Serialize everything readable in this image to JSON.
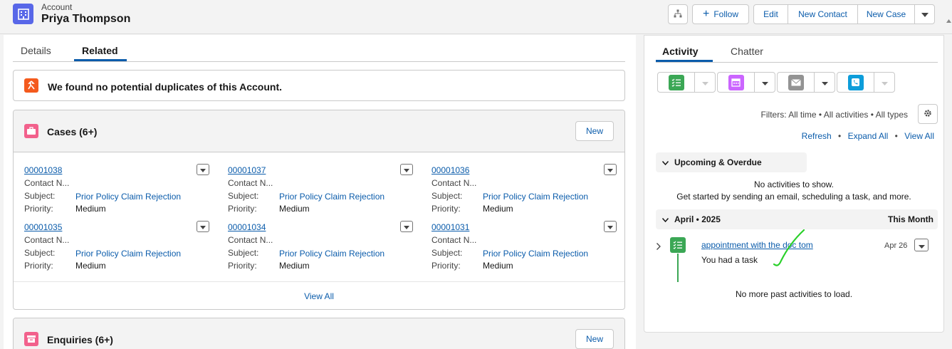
{
  "header": {
    "record_type": "Account",
    "record_name": "Priya Thompson",
    "follow_label": "Follow",
    "edit_label": "Edit",
    "new_contact_label": "New Contact",
    "new_case_label": "New Case"
  },
  "tabs": {
    "details": "Details",
    "related": "Related"
  },
  "duplicates": {
    "message": "We found no potential duplicates of this Account."
  },
  "cases": {
    "title": "Cases (6+)",
    "new_label": "New",
    "field_labels": {
      "contact": "Contact N...",
      "subject": "Subject:",
      "priority": "Priority:"
    },
    "items": [
      {
        "number": "00001038",
        "subject": "Prior Policy Claim Rejection",
        "priority": "Medium"
      },
      {
        "number": "00001037",
        "subject": "Prior Policy Claim Rejection",
        "priority": "Medium"
      },
      {
        "number": "00001036",
        "subject": "Prior Policy Claim Rejection",
        "priority": "Medium"
      },
      {
        "number": "00001035",
        "subject": "Prior Policy Claim Rejection",
        "priority": "Medium"
      },
      {
        "number": "00001034",
        "subject": "Prior Policy Claim Rejection",
        "priority": "Medium"
      },
      {
        "number": "00001031",
        "subject": "Prior Policy Claim Rejection",
        "priority": "Medium"
      }
    ],
    "view_all": "View All"
  },
  "enquiries": {
    "title": "Enquiries (6+)",
    "new_label": "New"
  },
  "activity": {
    "tabs": {
      "activity": "Activity",
      "chatter": "Chatter"
    },
    "filters": "Filters: All time • All activities • All types",
    "refresh": "Refresh",
    "expand_all": "Expand All",
    "view_all": "View All",
    "sep": "•",
    "upcoming_title": "Upcoming & Overdue",
    "no_activities": "No activities to show.",
    "get_started": "Get started by sending an email, scheduling a task, and more.",
    "month_title": "April • 2025",
    "this_month": "This Month",
    "task": {
      "title": "appointment with the doc tom",
      "subtitle": "You had a task",
      "date": "Apr 26"
    },
    "no_more": "No more past activities to load."
  },
  "colors": {
    "account_icon": "#5867e8",
    "task": "#3ba755",
    "event": "#cb65ff",
    "email": "#939393",
    "call": "#0d9dda",
    "case_icon": "#f2618c",
    "duplicate_icon": "#f45a1d",
    "link": "#0b5cab"
  }
}
